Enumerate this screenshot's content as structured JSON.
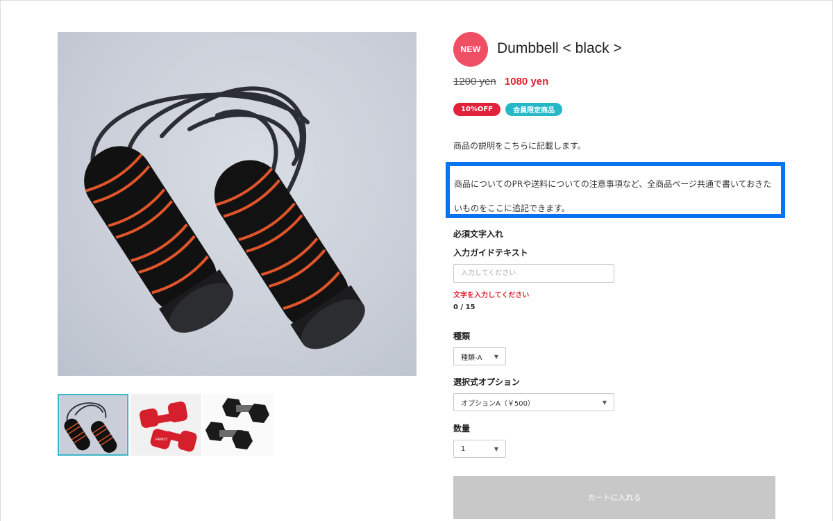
{
  "product": {
    "badge": "NEW",
    "title": "Dumbbell < black >",
    "price_old": "1200 yen",
    "price_new": "1080 yen",
    "tags": [
      "10%OFF",
      "会員限定商品"
    ],
    "description": "商品の説明をこちらに記載します。",
    "notice_line1": "商品についてのPRや送料についての注意事項など、全商品ページ共通で書いておきた",
    "notice_line2": "いものをここに追記できます。"
  },
  "form": {
    "required_text_label": "必須文字入れ",
    "guide_text_label": "入力ガイドテキスト",
    "text_input_placeholder": "入力してください",
    "text_input_value": "",
    "error_message": "文字を入力してください",
    "char_counter": "0 / 15",
    "type_label": "種類",
    "type_selected": "種類-A",
    "option_label": "選択式オプション",
    "option_selected": "オプションA（￥500）",
    "quantity_label": "数量",
    "quantity_selected": "1",
    "cart_button": "カートに入れる"
  },
  "gallery": {
    "thumbnails": [
      "jump-rope",
      "red-dumbbells",
      "black-hex-dumbbells"
    ],
    "selected_index": 0,
    "thumbnail_2_text": "FAMILY"
  },
  "colors": {
    "new_badge": "#ef4f63",
    "sale_price": "#e2202f",
    "tag_off": "#e2213a",
    "tag_member": "#25b8c6",
    "highlight_border": "#0a74ee",
    "thumb_selected_border": "#3bb7c8",
    "cart_button_disabled": "#c8c8c8"
  },
  "icons": {
    "select_caret": "▼"
  }
}
